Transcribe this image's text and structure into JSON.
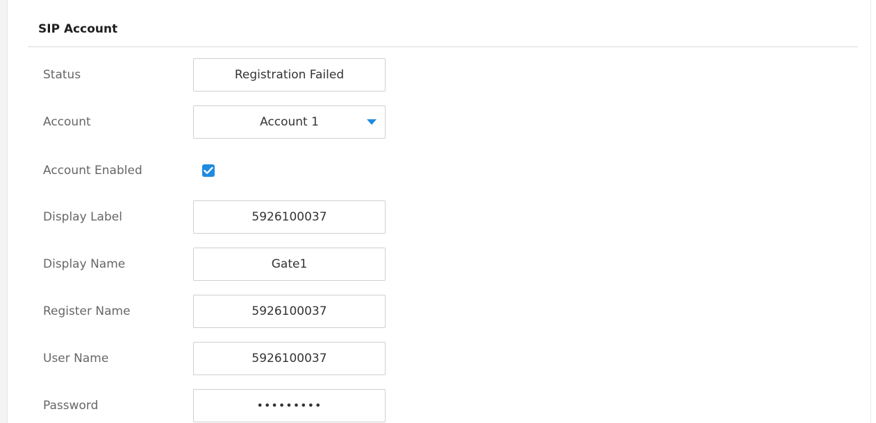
{
  "section": {
    "title": "SIP Account"
  },
  "fields": {
    "status": {
      "label": "Status",
      "value": "Registration Failed"
    },
    "account": {
      "label": "Account",
      "value": "Account 1"
    },
    "account_enabled": {
      "label": "Account Enabled",
      "checked": true
    },
    "display_label": {
      "label": "Display Label",
      "value": "5926100037"
    },
    "display_name": {
      "label": "Display Name",
      "value": "Gate1"
    },
    "register_name": {
      "label": "Register Name",
      "value": "5926100037"
    },
    "user_name": {
      "label": "User Name",
      "value": "5926100037"
    },
    "password": {
      "label": "Password",
      "value": "•••••••••"
    }
  },
  "icons": {
    "select_arrow": "chevron-down-icon",
    "checkbox_check": "check-icon"
  },
  "colors": {
    "accent": "#1e8ce0",
    "label_text": "#666666",
    "value_text": "#333333",
    "border": "#cfcfcf"
  }
}
